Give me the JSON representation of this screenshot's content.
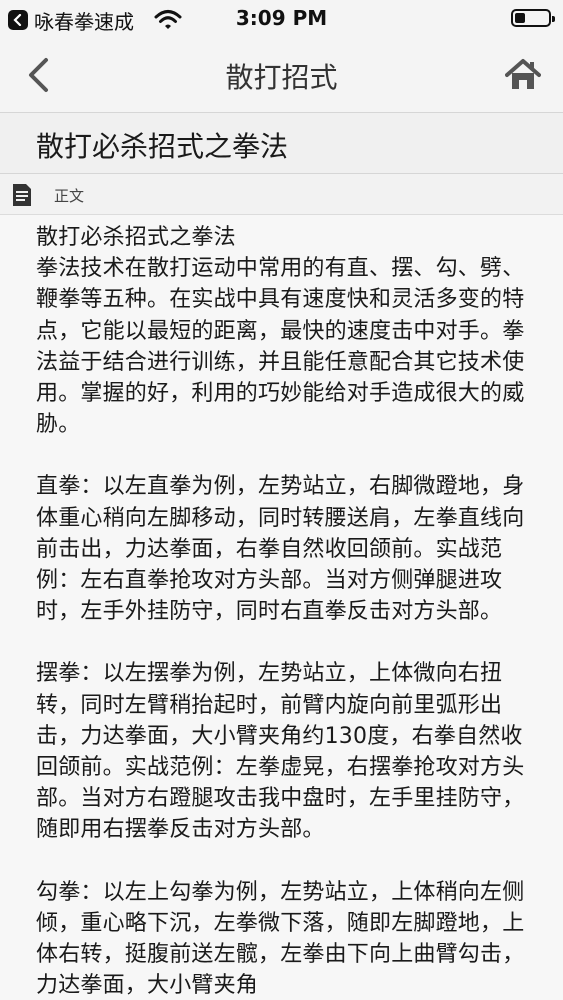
{
  "status_bar": {
    "back_app_label": "咏春拳速成",
    "time": "3:09 PM",
    "battery_level": 0.3
  },
  "nav": {
    "title": "散打招式",
    "back_icon": "chevron-left-icon",
    "home_icon": "home-icon"
  },
  "article": {
    "title": "散打必杀招式之拳法",
    "section_label": "正文",
    "paragraphs": [
      "散打必杀招式之拳法",
      "拳法技术在散打运动中常用的有直、摆、勾、劈、鞭拳等五种。在实战中具有速度快和灵活多变的特点，它能以最短的距离，最快的速度击中对手。拳法益于结合进行训练，并且能任意配合其它技术使用。掌握的好，利用的巧妙能给对手造成很大的威胁。",
      "直拳：以左直拳为例，左势站立，右脚微蹬地，身体重心稍向左脚移动，同时转腰送肩，左拳直线向前击出，力达拳面，右拳自然收回颌前。实战范例：左右直拳抢攻对方头部。当对方侧弹腿进攻时，左手外挂防守，同时右直拳反击对方头部。",
      "摆拳：以左摆拳为例，左势站立，上体微向右扭转，同时左臂稍抬起时，前臂内旋向前里弧形出击，力达拳面，大小臂夹角约130度，右拳自然收回颌前。实战范例：左拳虚晃，右摆拳抢攻对方头部。当对方右蹬腿攻击我中盘时，左手里挂防守，随即用右摆拳反击对方头部。",
      "勾拳：以左上勾拳为例，左势站立，上体稍向左侧倾，重心略下沉，左拳微下落，随即左脚蹬地，上体右转，挺腹前送左髋，左拳由下向上曲臂勾击，力达拳面，大小臂夹角"
    ]
  }
}
